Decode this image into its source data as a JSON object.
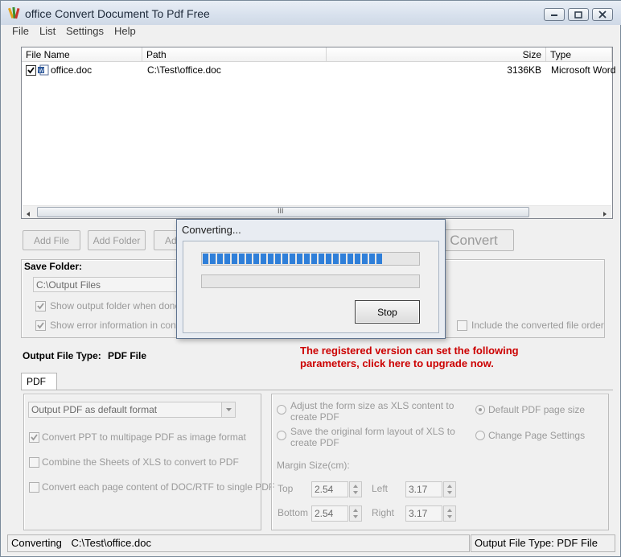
{
  "window": {
    "title": "office Convert Document To Pdf Free"
  },
  "menu": [
    "File",
    "List",
    "Settings",
    "Help"
  ],
  "list": {
    "columns": [
      "File Name",
      "Path",
      "Size",
      "Type"
    ],
    "rows": [
      {
        "checked": true,
        "name": "office.doc",
        "path": "C:\\Test\\office.doc",
        "size": "3136KB",
        "type": "Microsoft Word"
      }
    ],
    "scroll_grip": "III"
  },
  "buttons": {
    "add_file": "Add File",
    "add_folder": "Add Folder",
    "add_partial": "Ad",
    "convert": "Convert"
  },
  "save_folder": {
    "label": "Save Folder:",
    "path": "C:\\Output Files",
    "show_output_folder": "Show output folder when done",
    "show_error_info": "Show error information in convers",
    "include_converted_order": "Include the converted file order"
  },
  "output_type": {
    "label": "Output File Type:",
    "value": "PDF File"
  },
  "upgrade_notice": {
    "line1": "The registered version can set the following",
    "line2": "parameters, click here to upgrade now.",
    "color": "#cc0000"
  },
  "pdf_tab": {
    "tab_label": "PDF",
    "format_select": "Output PDF as default format",
    "convert_ppt": "Convert PPT to multipage PDF as image format",
    "combine_xls": "Combine the Sheets of XLS to convert to PDF",
    "convert_each_page": "Convert each page content of DOC/RTF to single PDF"
  },
  "page_options": {
    "adjust_form_line1": "Adjust the form size as XLS content to",
    "adjust_form_line2": "create PDF",
    "save_layout_line1": "Save the original form layout of XLS to",
    "save_layout_line2": "create PDF",
    "default_page_size": "Default PDF page size",
    "change_page_settings": "Change Page Settings",
    "margin_label": "Margin Size(cm):",
    "top_label": "Top",
    "top_value": "2.54",
    "left_label": "Left",
    "left_value": "3.17",
    "bottom_label": "Bottom",
    "bottom_value": "2.54",
    "right_label": "Right",
    "right_value": "3.17"
  },
  "dialog": {
    "title": "Converting...",
    "progress_fraction": 0.84,
    "secondary_progress_fraction": 0,
    "stop_label": "Stop"
  },
  "status": {
    "converting_label": "Converting",
    "converting_path": "C:\\Test\\office.doc",
    "output_type": "Output File Type:  PDF File"
  },
  "icons": {
    "app": "colored-pencils-icon",
    "file": "word-doc-icon"
  }
}
